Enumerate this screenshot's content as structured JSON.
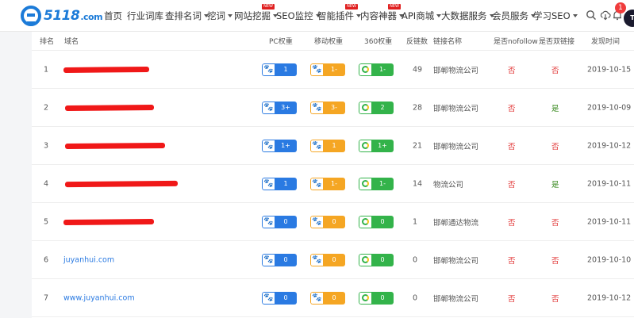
{
  "nav": {
    "logo_text": "5118",
    "logo_suffix": ".com",
    "items": [
      {
        "label": "首页",
        "caret": false,
        "badge": ""
      },
      {
        "label": "行业词库",
        "caret": false,
        "badge": ""
      },
      {
        "label": "查排名词",
        "caret": true,
        "badge": ""
      },
      {
        "label": "挖词",
        "caret": true,
        "badge": ""
      },
      {
        "label": "网站挖掘",
        "caret": true,
        "badge": "NEW"
      },
      {
        "label": "SEO监控",
        "caret": true,
        "badge": ""
      },
      {
        "label": "智能插件",
        "caret": true,
        "badge": "NEW"
      },
      {
        "label": "内容神器",
        "caret": true,
        "badge": "NEW"
      },
      {
        "label": "API商城",
        "caret": true,
        "badge": ""
      },
      {
        "label": "大数据服务",
        "caret": true,
        "badge": ""
      },
      {
        "label": "会员服务",
        "caret": true,
        "badge": ""
      },
      {
        "label": "学习SEO",
        "caret": true,
        "badge": ""
      }
    ],
    "notification_count": "1",
    "avatar_text": "T"
  },
  "table": {
    "headers": {
      "rank": "排名",
      "domain": "域名",
      "pc": "PC权重",
      "mobile": "移动权重",
      "s360": "360权重",
      "backlinks": "反链数",
      "link_name": "链接名称",
      "nofollow": "是否nofollow",
      "bidirectional": "是否双链接",
      "found_time": "发现时间"
    },
    "rows": [
      {
        "rank": "1",
        "domain": "",
        "redacted": true,
        "pc": "1",
        "mobile": "1-",
        "s360": "1-",
        "backlinks": "49",
        "link_name": "邯郸物流公司",
        "nofollow": "否",
        "bidirectional": "否",
        "found_time": "2019-10-15"
      },
      {
        "rank": "2",
        "domain": "",
        "redacted": true,
        "pc": "3+",
        "mobile": "3-",
        "s360": "2",
        "backlinks": "28",
        "link_name": "邯郸物流公司",
        "nofollow": "否",
        "bidirectional": "是",
        "found_time": "2019-10-09"
      },
      {
        "rank": "3",
        "domain": "",
        "redacted": true,
        "pc": "1+",
        "mobile": "1",
        "s360": "1+",
        "backlinks": "21",
        "link_name": "邯郸物流公司",
        "nofollow": "否",
        "bidirectional": "否",
        "found_time": "2019-10-12"
      },
      {
        "rank": "4",
        "domain": "",
        "redacted": true,
        "pc": "1",
        "mobile": "1-",
        "s360": "1-",
        "backlinks": "14",
        "link_name": "物流公司",
        "nofollow": "否",
        "bidirectional": "是",
        "found_time": "2019-10-11"
      },
      {
        "rank": "5",
        "domain": "",
        "redacted": true,
        "pc": "0",
        "mobile": "0",
        "s360": "0",
        "backlinks": "1",
        "link_name": "邯郸通达物流",
        "nofollow": "否",
        "bidirectional": "否",
        "found_time": "2019-10-11"
      },
      {
        "rank": "6",
        "domain": "juyanhui.com",
        "redacted": false,
        "pc": "0",
        "mobile": "0",
        "s360": "0",
        "backlinks": "0",
        "link_name": "邯郸物流公司",
        "nofollow": "否",
        "bidirectional": "否",
        "found_time": "2019-10-10"
      },
      {
        "rank": "7",
        "domain": "www.juyanhui.com",
        "redacted": false,
        "pc": "0",
        "mobile": "0",
        "s360": "0",
        "backlinks": "0",
        "link_name": "邯郸物流公司",
        "nofollow": "否",
        "bidirectional": "否",
        "found_time": "2019-10-12"
      }
    ]
  }
}
